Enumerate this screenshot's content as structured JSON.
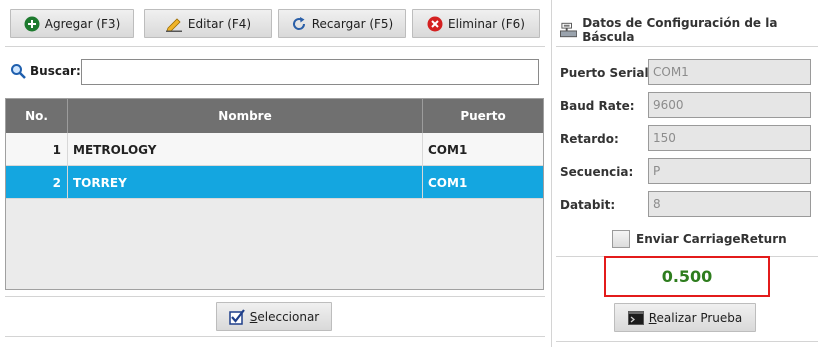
{
  "toolbar": {
    "add_label": "Agregar (F3)",
    "edit_label": "Editar (F4)",
    "reload_label": "Recargar (F5)",
    "delete_label": "Eliminar (F6)"
  },
  "search": {
    "label": "Buscar:",
    "value": ""
  },
  "table": {
    "headers": {
      "no": "No.",
      "name": "Nombre",
      "port": "Puerto"
    },
    "rows": [
      {
        "no": "1",
        "name": "METROLOGY",
        "port": "COM1"
      },
      {
        "no": "2",
        "name": "TORREY",
        "port": "COM1"
      }
    ],
    "selected_index": 1
  },
  "select_button": {
    "underlined_letter": "S",
    "rest": "eleccionar"
  },
  "config": {
    "title": "Datos de Configuración de la Báscula",
    "fields": [
      {
        "label": "Puerto Serial:",
        "value": "COM1"
      },
      {
        "label": "Baud Rate:",
        "value": "9600"
      },
      {
        "label": "Retardo:",
        "value": "150"
      },
      {
        "label": "Secuencia:",
        "value": "P"
      },
      {
        "label": "Databit:",
        "value": "8"
      }
    ],
    "carriage_return_label": "Enviar CarriageReturn",
    "carriage_return_checked": false,
    "result": "0.500",
    "test_button": {
      "underlined_letter": "R",
      "rest": "ealizar Prueba"
    }
  },
  "colors": {
    "selected_row": "#14a6e0",
    "header_bg": "#707070",
    "result_border": "#e31b1b",
    "result_text": "#2e7d1e"
  }
}
